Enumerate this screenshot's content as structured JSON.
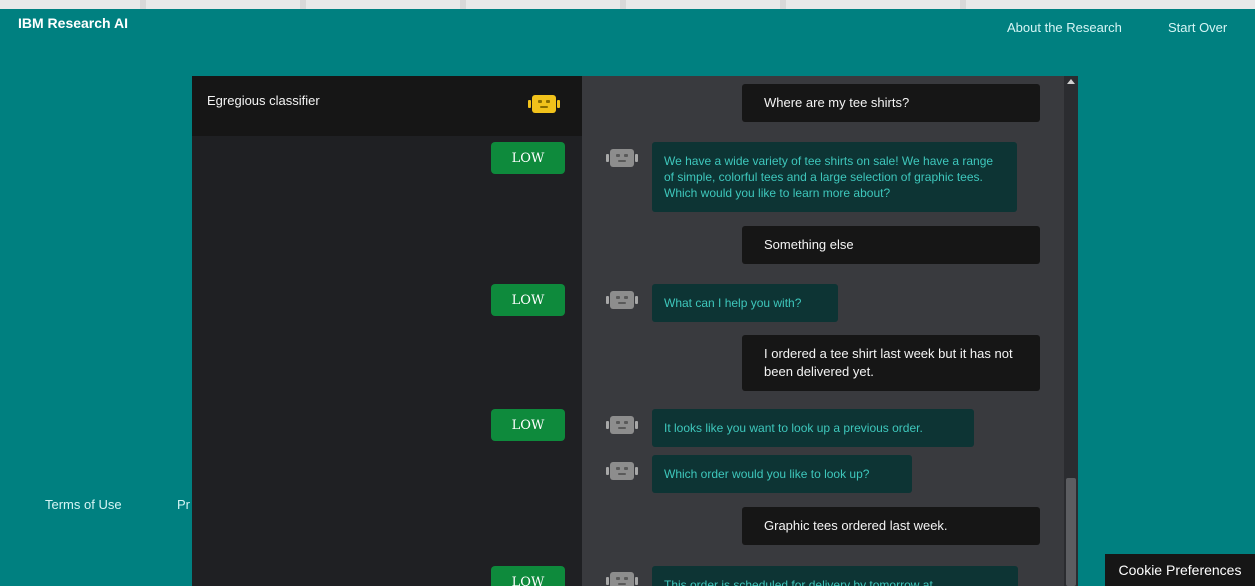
{
  "header": {
    "brand": "IBM Research AI",
    "nav": {
      "about": "About the Research",
      "start_over": "Start Over"
    }
  },
  "footer": {
    "terms": "Terms of Use",
    "partial": "Pr"
  },
  "classifier": {
    "title": "Egregious classifier",
    "header_icon": "robot-icon",
    "header_icon_color": "#f1c21b",
    "badges": [
      "LOW",
      "LOW",
      "LOW",
      "LOW"
    ],
    "badge_color": "#0e8a3c"
  },
  "chat": {
    "user_messages": [
      "Where are my tee shirts?",
      "Something else",
      "I ordered a tee shirt last week but it has not been delivered yet.",
      "Graphic tees ordered last week."
    ],
    "bot_messages": [
      "We have a wide variety of tee shirts on sale! We have a range of simple, colorful tees and a large selection of graphic tees. Which would you like to learn more about?",
      "What can I help you with?",
      "It looks like you want to look up a previous order.",
      "Which order would you like to look up?",
      "This order is scheduled for delivery by tomorrow at"
    ],
    "bot_avatar_icon": "robot-icon",
    "bot_avatar_color": "#8d8d8d"
  },
  "cookie": {
    "label": "Cookie Preferences"
  },
  "colors": {
    "page_background": "#008080",
    "bot_text": "#3ec7bc",
    "bot_bubble": "#0d3434",
    "user_bubble": "#161616"
  }
}
